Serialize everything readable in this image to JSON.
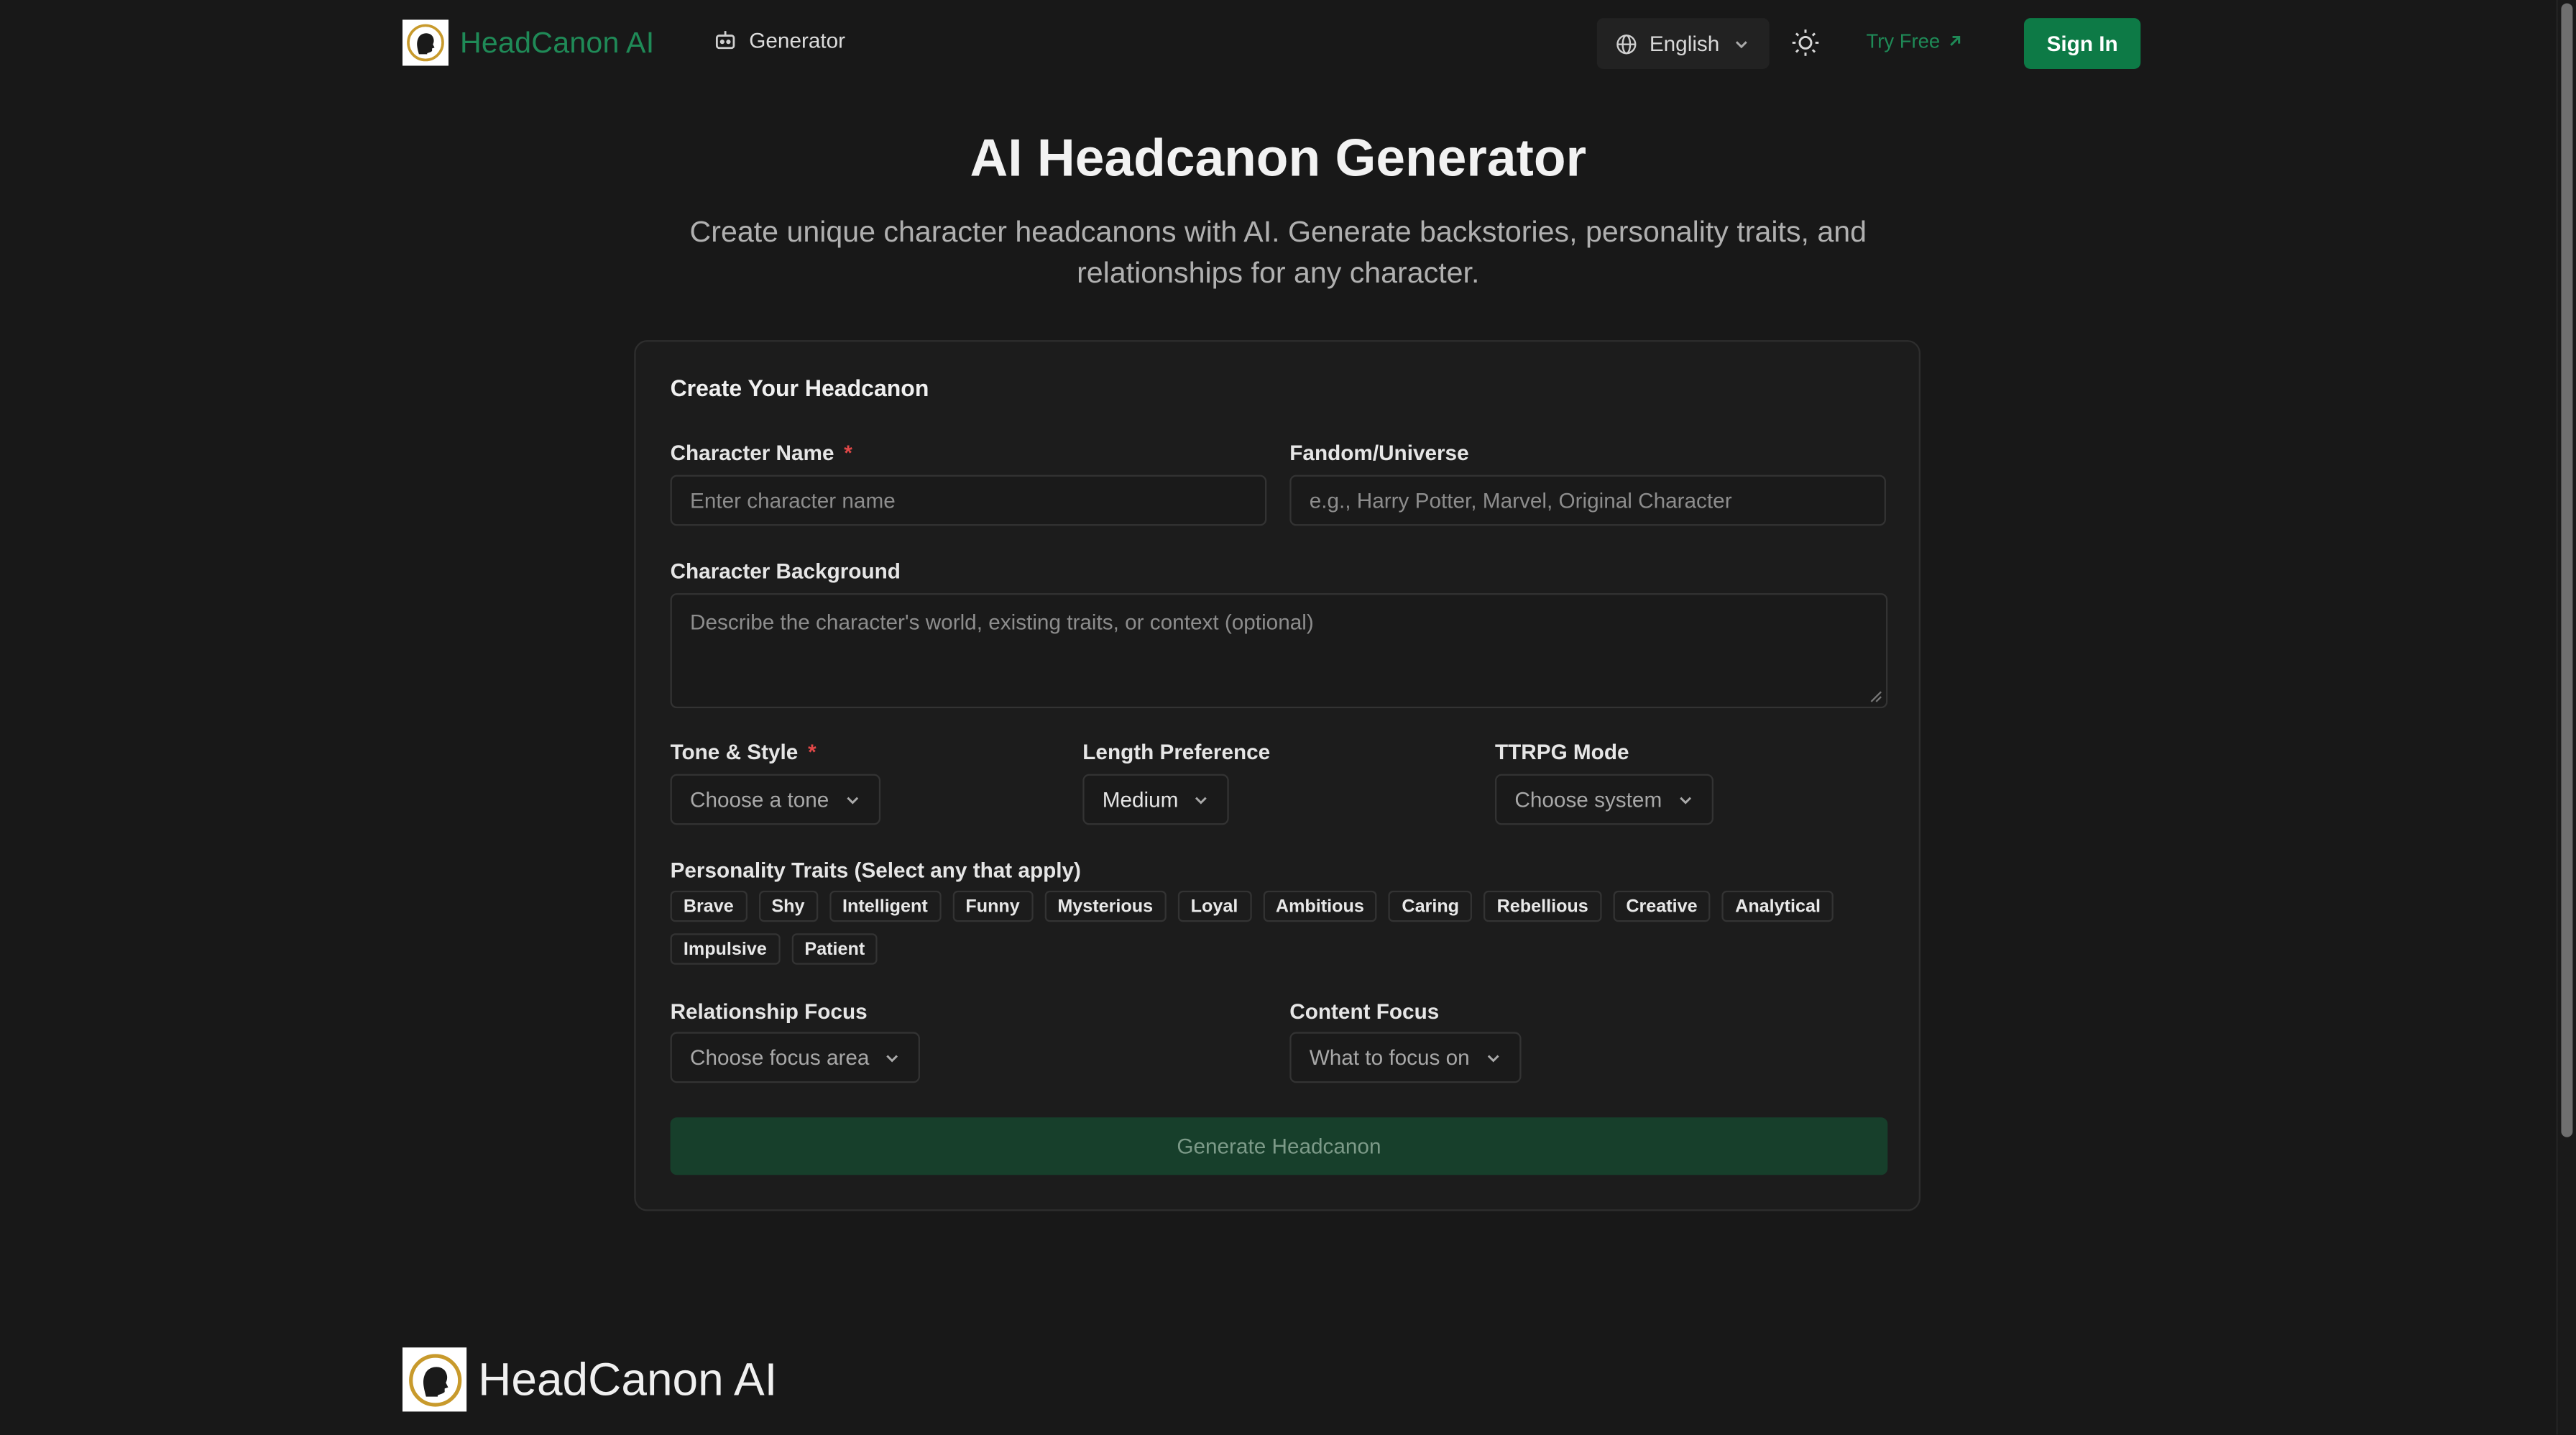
{
  "header": {
    "brand": "HeadCanon AI",
    "nav_generator": "Generator",
    "language": "English",
    "try_free": "Try Free",
    "sign_in": "Sign In"
  },
  "hero": {
    "title": "AI Headcanon Generator",
    "subtitle": "Create unique character headcanons with AI. Generate backstories, personality traits, and relationships for any character."
  },
  "form": {
    "card_title": "Create Your Headcanon",
    "character_name": {
      "label": "Character Name",
      "required_mark": "*",
      "placeholder": "Enter character name"
    },
    "fandom": {
      "label": "Fandom/Universe",
      "placeholder": "e.g., Harry Potter, Marvel, Original Character"
    },
    "background": {
      "label": "Character Background",
      "placeholder": "Describe the character's world, existing traits, or context (optional)"
    },
    "tone": {
      "label": "Tone & Style",
      "required_mark": "*",
      "value": "Choose a tone"
    },
    "length": {
      "label": "Length Preference",
      "value": "Medium"
    },
    "ttrpg": {
      "label": "TTRPG Mode",
      "value": "Choose system"
    },
    "traits_label": "Personality Traits (Select any that apply)",
    "traits": [
      "Brave",
      "Shy",
      "Intelligent",
      "Funny",
      "Mysterious",
      "Loyal",
      "Ambitious",
      "Caring",
      "Rebellious",
      "Creative",
      "Analytical",
      "Impulsive",
      "Patient"
    ],
    "relationship": {
      "label": "Relationship Focus",
      "value": "Choose focus area"
    },
    "content": {
      "label": "Content Focus",
      "value": "What to focus on"
    },
    "submit": "Generate Headcanon"
  },
  "footer": {
    "brand": "HeadCanon AI"
  },
  "colors": {
    "accent": "#0d7a46",
    "brand_text": "#1f8a57",
    "required": "#e24848",
    "background": "#181818"
  }
}
